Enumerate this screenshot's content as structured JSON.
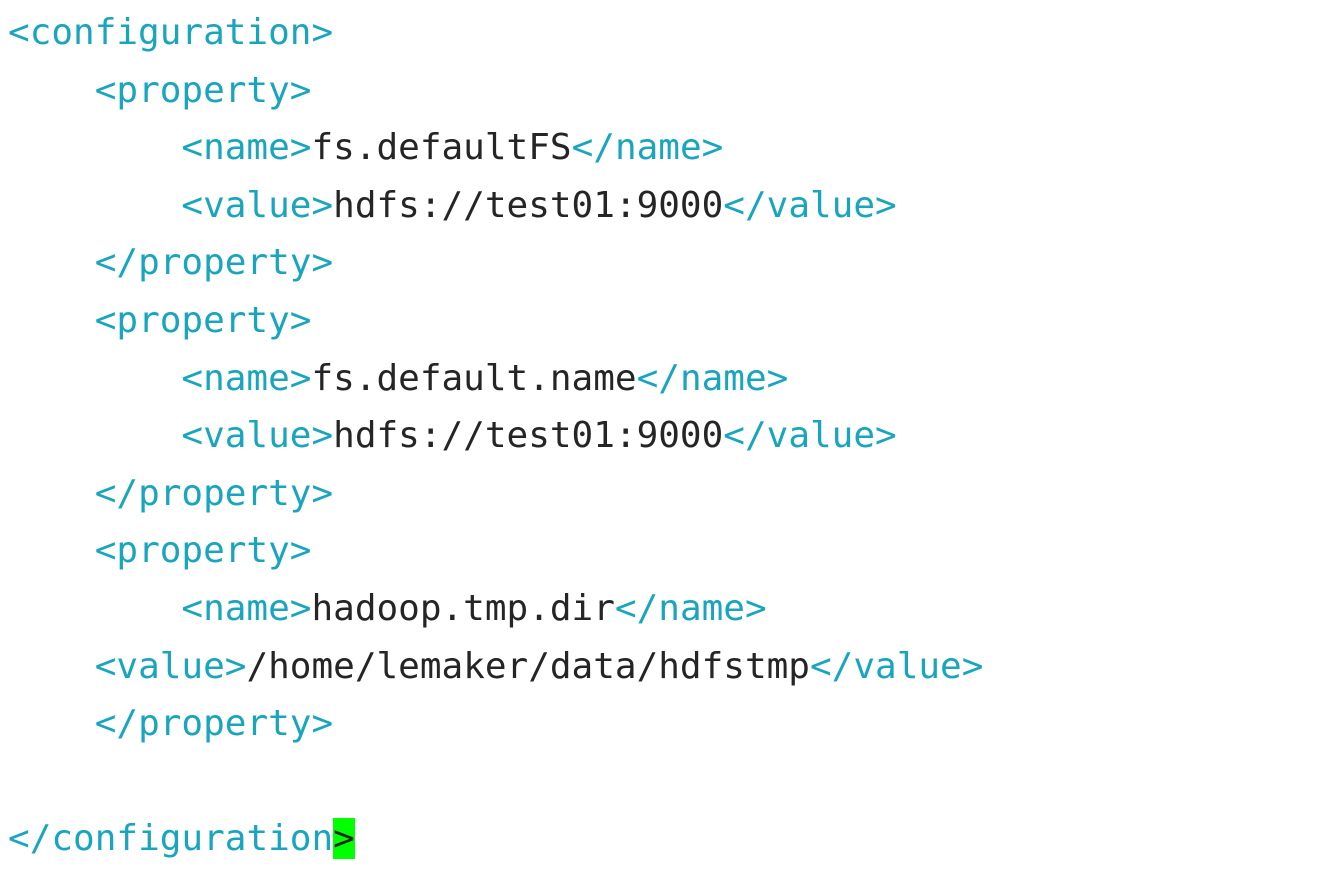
{
  "syntax": {
    "lt": "<",
    "gt": ">",
    "slash": "/"
  },
  "tags": {
    "configuration": "configuration",
    "property": "property",
    "name": "name",
    "value": "value"
  },
  "properties": [
    {
      "name": "fs.defaultFS",
      "value": "hdfs://test01:9000"
    },
    {
      "name": "fs.default.name",
      "value": "hdfs://test01:9000"
    },
    {
      "name": "hadoop.tmp.dir",
      "value": "/home/lemaker/data/hdfstmp"
    }
  ],
  "cursor_char": ">"
}
